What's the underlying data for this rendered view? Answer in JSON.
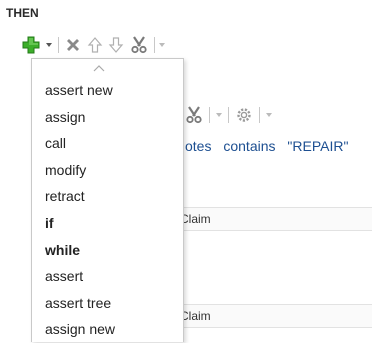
{
  "section": {
    "label": "THEN"
  },
  "toolbar": {
    "add_icon": "add-icon",
    "delete_icon": "delete-icon",
    "move_up_icon": "move-up-icon",
    "move_down_icon": "move-down-icon",
    "cut_icon": "cut-icon",
    "colors": {
      "add": "#3cae2a",
      "icon_gray": "#8a8a8a",
      "icon_light": "#b8b8b8"
    }
  },
  "menu": {
    "items": [
      {
        "label": "assert new",
        "bold": false
      },
      {
        "label": "assign",
        "bold": false
      },
      {
        "label": "call",
        "bold": false
      },
      {
        "label": "modify",
        "bold": false
      },
      {
        "label": "retract",
        "bold": false
      },
      {
        "label": "if",
        "bold": true
      },
      {
        "label": "while",
        "bold": true
      },
      {
        "label": "assert",
        "bold": false
      },
      {
        "label": "assert tree",
        "bold": false
      },
      {
        "label": "assign new",
        "bold": false
      }
    ]
  },
  "background": {
    "condition_parts": [
      "otes",
      "contains",
      "\"REPAIR\""
    ],
    "rows": [
      "Claim",
      "Claim"
    ]
  }
}
